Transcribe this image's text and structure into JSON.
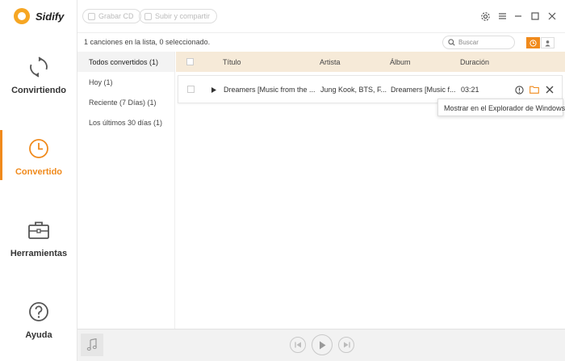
{
  "app": {
    "name": "Sidify",
    "accent": "#f08a1c"
  },
  "sidebar": {
    "items": [
      {
        "label": "Convirtiendo",
        "icon": "refresh-icon",
        "active": false
      },
      {
        "label": "Convertido",
        "icon": "clock-icon",
        "active": true
      },
      {
        "label": "Herramientas",
        "icon": "toolbox-icon",
        "active": false
      },
      {
        "label": "Ayuda",
        "icon": "help-icon",
        "active": false
      }
    ]
  },
  "toolbar": {
    "burn_cd": "Grabar CD",
    "upload_share": "Subir y compartir"
  },
  "status": {
    "summary": "1 canciones en la lista, 0 seleccionado.",
    "search_placeholder": "Buscar"
  },
  "filters": [
    {
      "label": "Todos convertidos (1)",
      "active": true
    },
    {
      "label": "Hoy (1)",
      "active": false
    },
    {
      "label": "Reciente (7 Días) (1)",
      "active": false
    },
    {
      "label": "Los últimos 30 días (1)",
      "active": false
    }
  ],
  "table": {
    "columns": {
      "title": "Título",
      "artist": "Artista",
      "album": "Álbum",
      "duration": "Duración"
    },
    "rows": [
      {
        "title": "Dreamers [Music from the ...",
        "artist": "Jung Kook, BTS, F...",
        "album": "Dreamers [Music f...",
        "duration": "03:21"
      }
    ]
  },
  "tooltip": "Mostrar en el Explorador de Windows"
}
